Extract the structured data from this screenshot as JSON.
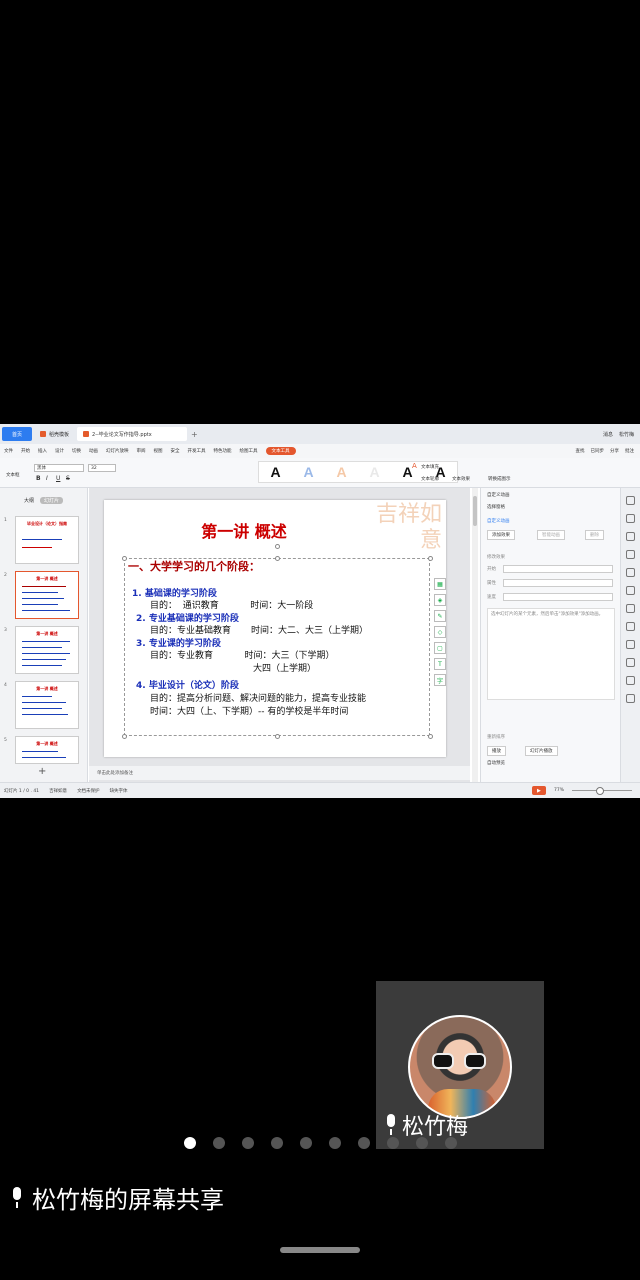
{
  "share": {
    "tabs": {
      "home": "首页",
      "template": "稻壳模板",
      "doc": "2--毕业论文写作指导.pptx",
      "plus": "+"
    },
    "tabbar_right": [
      "消息",
      "松竹梅"
    ],
    "menu": {
      "file": "文件",
      "items": [
        "开始",
        "插入",
        "设计",
        "切换",
        "动画",
        "幻灯片放映",
        "审阅",
        "视图",
        "安全",
        "开发工具",
        "特色功能",
        "绘图工具"
      ],
      "active": "文本工具",
      "right": [
        "查找",
        "已同步",
        "分享",
        "批注"
      ]
    },
    "ribbon": {
      "font_name": "黑体",
      "font_size": "32",
      "text_box": "文本框",
      "text_fill": "文本填充",
      "text_outline": "文本轮廓",
      "text_effect": "文本效果",
      "convert": "转换成图示",
      "style_letters": [
        "A",
        "A",
        "A",
        "A",
        "A",
        "A"
      ]
    },
    "sidebar": {
      "tab_outline": "大纲",
      "tab_slides": "幻灯片",
      "slide_numbers": [
        "1",
        "2",
        "3",
        "4",
        "5"
      ],
      "thumb_titles": [
        "毕业设计（论文）指南",
        "第一讲 概述",
        "第一讲 概述",
        "第一讲 概述",
        "第一讲 概述"
      ],
      "add": "+"
    },
    "slide": {
      "title": "第一讲    概述",
      "subtitle": "一、大学学习的几个阶段：",
      "items": [
        {
          "head": "1.  基础课的学习阶段",
          "lines": [
            "目的：  通识教育           时间：大一阶段"
          ]
        },
        {
          "head": "2.  专业基础课的学习阶段",
          "lines": [
            "目的：专业基础教育       时间：大二、大三（上学期）"
          ]
        },
        {
          "head": "3.  专业课的学习阶段",
          "lines": [
            "目的：专业教育           时间：大三（下学期）",
            "                                    大四（上学期）"
          ]
        },
        {
          "head": "4.  毕业设计（论文）阶段",
          "lines": [
            "目的：提高分析问题、解决问题的能力，提高专业技能",
            "时间：大四（上、下学期）-- 有的学校是半年时间"
          ]
        }
      ],
      "seal_text": "吉祥如意"
    },
    "notes": "单击此处添加备注",
    "right_panel": {
      "title": "自定义动画",
      "select_pane": "选择窗格",
      "custom_anim": "自定义动画",
      "add_effect": "添加效果",
      "smart_anim": "智能动画",
      "delete": "删除",
      "modify": "修改效果",
      "start": "开始",
      "property": "属性",
      "speed": "速度",
      "description": "选中幻灯片的某个元素，然后单击\"添加效果\"添加动画。",
      "reorder": "重新排序",
      "play": "播放",
      "slideshow": "幻灯片播放",
      "autopreview": "自动预览"
    },
    "status": {
      "slide_count": "幻灯片 1 / 0 . 41",
      "theme": "吉祥如意",
      "protect": "文档未保护",
      "font": "缺失字体",
      "zoom": "77%"
    }
  },
  "video": {
    "name": "松竹梅"
  },
  "pager": {
    "count": 10,
    "active_index": 0
  },
  "share_label": "松竹梅的屏幕共享"
}
